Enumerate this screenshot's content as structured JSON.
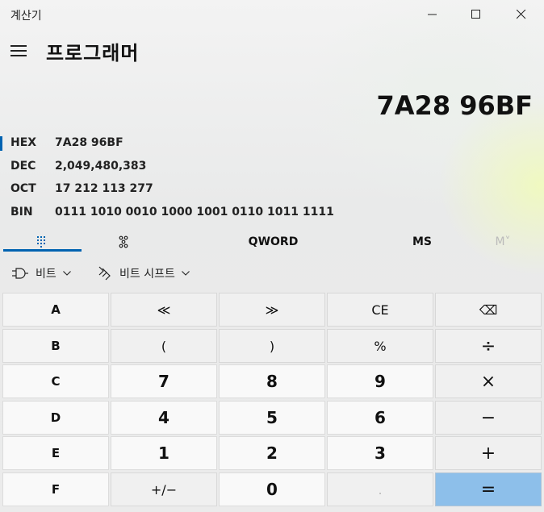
{
  "window": {
    "title": "계산기",
    "min_icon": "minimize-icon",
    "max_icon": "maximize-icon",
    "close_icon": "close-icon"
  },
  "header": {
    "menu_icon": "hamburger-menu-icon",
    "mode_title": "프로그래머"
  },
  "display": {
    "value": "7A28 96BF"
  },
  "radix": [
    {
      "name": "HEX",
      "value": "7A28 96BF",
      "selected": true
    },
    {
      "name": "DEC",
      "value": "2,049,480,383",
      "selected": false
    },
    {
      "name": "OCT",
      "value": "17 212 113 277",
      "selected": false
    },
    {
      "name": "BIN",
      "value": "0111 1010 0010 1000 1001 0110 1011 1111",
      "selected": false
    }
  ],
  "tabs": {
    "keypad_icon": "full-keypad-icon",
    "bits_icon": "bit-toggling-keypad-icon",
    "word_size": "QWORD",
    "memory_store": "MS",
    "memory_list": "M˅"
  },
  "bit_controls": {
    "bitwise_label": "비트",
    "bitshift_label": "비트 시프트"
  },
  "keys": [
    [
      "A",
      "≪",
      "≫",
      "CE",
      "⌫"
    ],
    [
      "B",
      "(",
      ")",
      "%",
      "÷"
    ],
    [
      "C",
      "7",
      "8",
      "9",
      "×"
    ],
    [
      "D",
      "4",
      "5",
      "6",
      "−"
    ],
    [
      "E",
      "1",
      "2",
      "3",
      "+"
    ],
    [
      "F",
      "+/−",
      "0",
      ".",
      "="
    ]
  ],
  "colors": {
    "accent": "#0063b1",
    "equals_bg": "#8dbfea"
  }
}
